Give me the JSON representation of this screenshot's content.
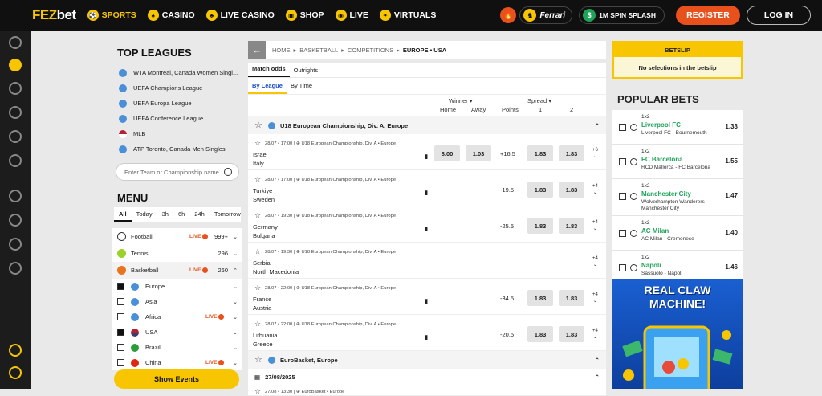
{
  "brand": {
    "fez": "FEZ",
    "bet": "bet"
  },
  "nav": [
    {
      "label": "SPORTS",
      "icon": "sports-icon",
      "active": true
    },
    {
      "label": "CASINO",
      "icon": "casino-icon"
    },
    {
      "label": "LIVE CASINO",
      "icon": "live-casino-icon"
    },
    {
      "label": "SHOP",
      "icon": "shop-icon"
    },
    {
      "label": "LIVE",
      "icon": "live-icon"
    },
    {
      "label": "VIRTUALS",
      "icon": "virtuals-icon"
    }
  ],
  "promo": {
    "ferrari": "Ferrari",
    "splash": "1M SPIN SPLASH"
  },
  "auth": {
    "register": "REGISTER",
    "login": "LOG IN"
  },
  "top_leagues": {
    "title": "TOP LEAGUES",
    "items": [
      {
        "label": "WTA Montreal, Canada Women Singl..."
      },
      {
        "label": "UEFA Champions League"
      },
      {
        "label": "UEFA Europa League"
      },
      {
        "label": "UEFA Conference League"
      },
      {
        "label": "MLB"
      },
      {
        "label": "ATP Toronto, Canada Men Singles"
      }
    ],
    "search_placeholder": "Enter Team or Championship name"
  },
  "menu": {
    "title": "MENU",
    "tabs": [
      "All",
      "Today",
      "3h",
      "6h",
      "24h",
      "Tomorrow"
    ],
    "sports": [
      {
        "name": "Football",
        "live": "LIVE",
        "count": "999+"
      },
      {
        "name": "Tennis",
        "live": "",
        "count": "296"
      },
      {
        "name": "Basketball",
        "live": "LIVE",
        "count": "260"
      }
    ],
    "regions": [
      {
        "name": "Europe",
        "checked": true,
        "live": ""
      },
      {
        "name": "Asia",
        "checked": false,
        "live": ""
      },
      {
        "name": "Africa",
        "checked": false,
        "live": "LIVE"
      },
      {
        "name": "USA",
        "checked": true,
        "live": ""
      },
      {
        "name": "Brazil",
        "checked": false,
        "live": ""
      },
      {
        "name": "China",
        "checked": false,
        "live": "LIVE"
      }
    ],
    "show_events": "Show Events"
  },
  "breadcrumb": {
    "home": "HOME",
    "sport": "BASKETBALL",
    "comps": "COMPETITIONS",
    "region": "EUROPE • USA"
  },
  "market_tabs": [
    "Match odds",
    "Outrights"
  ],
  "sort_tabs": [
    "By League",
    "By Time"
  ],
  "columns": {
    "winner": "Winner",
    "spread": "Spread",
    "home": "Home",
    "away": "Away",
    "points": "Points",
    "one": "1",
    "two": "2"
  },
  "competition1": "U18 European Championship, Div. A, Europe",
  "matches": [
    {
      "meta": "28/07 • 17:00 | ⊕ U18 European Championship, Div. A • Europe",
      "home": "Israel",
      "away": "Italy",
      "winner_home": "8.00",
      "winner_away": "1.03",
      "points": "+16.5",
      "s1": "1.83",
      "s2": "1.83",
      "more": "+6"
    },
    {
      "meta": "28/07 • 17:00 | ⊕ U18 European Championship, Div. A • Europe",
      "home": "Turkiye",
      "away": "Sweden",
      "winner_home": "",
      "winner_away": "",
      "points": "-19.5",
      "s1": "1.83",
      "s2": "1.83",
      "more": "+4"
    },
    {
      "meta": "28/07 • 19:30 | ⊕ U18 European Championship, Div. A • Europe",
      "home": "Germany",
      "away": "Bulgaria",
      "winner_home": "",
      "winner_away": "",
      "points": "-25.5",
      "s1": "1.83",
      "s2": "1.83",
      "more": "+4"
    },
    {
      "meta": "28/07 • 19:30 | ⊕ U18 European Championship, Div. A • Europe",
      "home": "Serbia",
      "away": "North Macedonia",
      "winner_home": "",
      "winner_away": "",
      "points": "",
      "s1": "",
      "s2": "",
      "more": "+4"
    },
    {
      "meta": "28/07 • 22:00 | ⊕ U18 European Championship, Div. A • Europe",
      "home": "France",
      "away": "Austria",
      "winner_home": "",
      "winner_away": "",
      "points": "-34.5",
      "s1": "1.83",
      "s2": "1.83",
      "more": "+4"
    },
    {
      "meta": "28/07 • 22:00 | ⊕ U18 European Championship, Div. A • Europe",
      "home": "Lithuania",
      "away": "Greece",
      "winner_home": "",
      "winner_away": "",
      "points": "-20.5",
      "s1": "1.83",
      "s2": "1.83",
      "more": "+4"
    }
  ],
  "competition2": "EuroBasket, Europe",
  "date2": "27/08/2025",
  "match_last_meta": "27/08 • 13:30 | ⊕ EuroBasket • Europe",
  "betslip": {
    "title": "BETSLIP",
    "empty": "No selections in the betslip"
  },
  "popular": {
    "title": "POPULAR BETS",
    "items": [
      {
        "market": "1x2",
        "pick": "Liverpool FC",
        "match": "Liverpool FC - Bournemouth",
        "odd": "1.33"
      },
      {
        "market": "1x2",
        "pick": "FC Barcelona",
        "match": "RCD Mallorca - FC Barcelona",
        "odd": "1.55"
      },
      {
        "market": "1x2",
        "pick": "Manchester City",
        "match": "Wolverhampton Wanderers - Manchester City",
        "odd": "1.47"
      },
      {
        "market": "1x2",
        "pick": "AC Milan",
        "match": "AC Milan - Cremonese",
        "odd": "1.40"
      },
      {
        "market": "1x2",
        "pick": "Napoli",
        "match": "Sassuolo - Napoli",
        "odd": "1.46"
      }
    ]
  },
  "banner": {
    "line1": "REAL CLAW",
    "line2": "MACHINE!"
  },
  "colors": {
    "accent": "#f7c600",
    "register": "#e8501c",
    "pick": "#1fa35a"
  }
}
